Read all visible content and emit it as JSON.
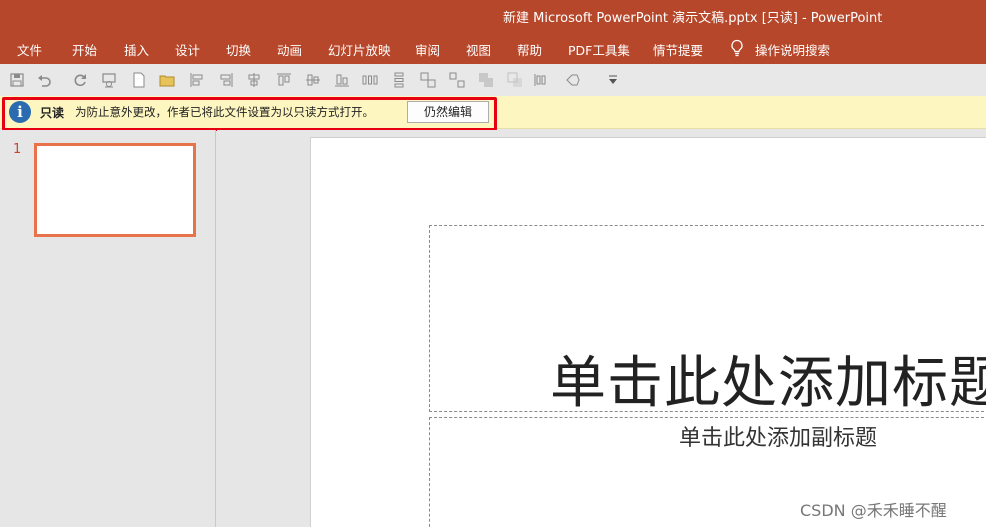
{
  "window": {
    "title": "新建 Microsoft PowerPoint 演示文稿.pptx [只读]  -  PowerPoint"
  },
  "menu": {
    "items": [
      "文件",
      "开始",
      "插入",
      "设计",
      "切换",
      "动画",
      "幻灯片放映",
      "审阅",
      "视图",
      "帮助",
      "PDF工具集",
      "情节提要"
    ],
    "search_label": "操作说明搜索"
  },
  "quick_access": {
    "icons": [
      "save-icon",
      "undo-icon",
      "redo-icon",
      "presentation-icon",
      "new-file-icon",
      "open-folder-icon",
      "align-left-icon",
      "align-right-icon",
      "align-center-icon",
      "align-top-icon",
      "align-middle-icon",
      "align-bottom-icon",
      "distribute-horizontal-icon",
      "distribute-vertical-icon",
      "group-icon",
      "ungroup-icon",
      "bring-forward-icon",
      "send-backward-icon",
      "distribute-icon",
      "shapes-icon",
      "customize-dropdown-icon"
    ]
  },
  "info_bar": {
    "label": "只读",
    "message": "为防止意外更改，作者已将此文件设置为以只读方式打开。",
    "button": "仍然编辑",
    "colors": {
      "highlight": "#e60012",
      "icon": "#2b6cb0"
    }
  },
  "slides_pane": {
    "slide_number": "1"
  },
  "slide": {
    "title_placeholder": "单击此处添加标题",
    "subtitle_placeholder": "单击此处添加副标题"
  },
  "watermark": "CSDN @禾禾睡不醒",
  "colors": {
    "ribbon": "#b7472a",
    "info_bg": "#fdf6c1",
    "thumb_border": "#e8734a"
  }
}
